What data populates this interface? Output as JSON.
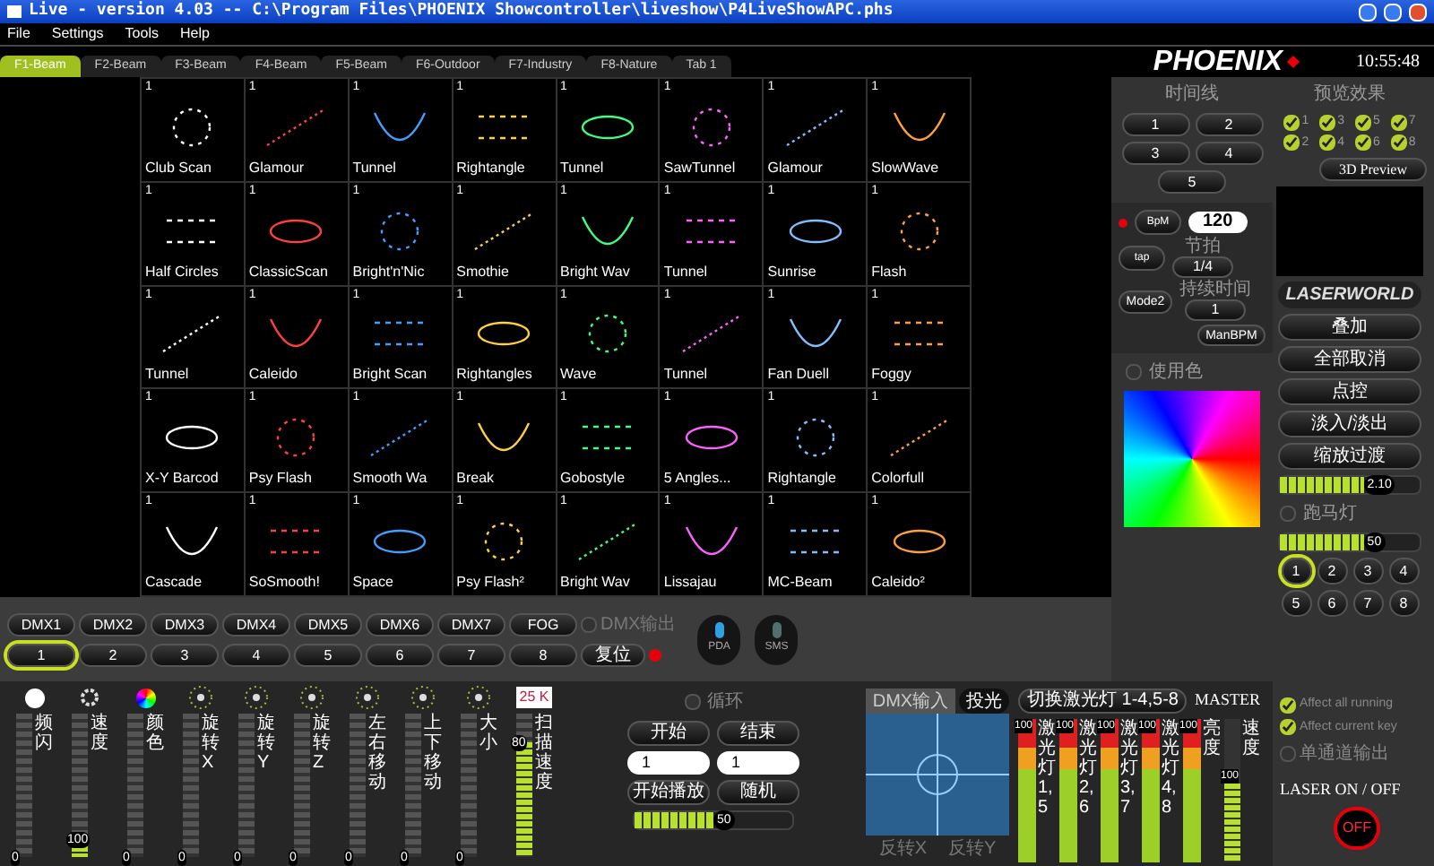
{
  "window": {
    "title": "Live - version 4.03 -- C:\\Program Files\\PHOENIX Showcontroller\\liveshow\\P4LiveShowAPC.phs"
  },
  "menu": [
    "File",
    "Settings",
    "Tools",
    "Help"
  ],
  "tabs": [
    {
      "label": "F1-Beam",
      "selected": true
    },
    {
      "label": "F2-Beam",
      "selected": false
    },
    {
      "label": "F3-Beam",
      "selected": false
    },
    {
      "label": "F4-Beam",
      "selected": false
    },
    {
      "label": "F5-Beam",
      "selected": false
    },
    {
      "label": "F6-Outdoor",
      "selected": false
    },
    {
      "label": "F7-Industry",
      "selected": false
    },
    {
      "label": "F8-Nature",
      "selected": false
    },
    {
      "label": "Tab 1",
      "selected": false
    }
  ],
  "header": {
    "logo": "PHOENIX",
    "clock": "10:55:48"
  },
  "effects": [
    {
      "number": "1",
      "label": "Club Scan"
    },
    {
      "number": "1",
      "label": "Glamour"
    },
    {
      "number": "1",
      "label": "Tunnel"
    },
    {
      "number": "1",
      "label": "Rightangle"
    },
    {
      "number": "1",
      "label": "Tunnel"
    },
    {
      "number": "1",
      "label": "SawTunnel"
    },
    {
      "number": "1",
      "label": "Glamour"
    },
    {
      "number": "1",
      "label": "SlowWave"
    },
    {
      "number": "1",
      "label": "Half Circles"
    },
    {
      "number": "1",
      "label": "ClassicScan"
    },
    {
      "number": "1",
      "label": "Bright'n'Nic"
    },
    {
      "number": "1",
      "label": "Smothie"
    },
    {
      "number": "1",
      "label": "Bright Wav"
    },
    {
      "number": "1",
      "label": "Tunnel"
    },
    {
      "number": "1",
      "label": "Sunrise"
    },
    {
      "number": "1",
      "label": "Flash"
    },
    {
      "number": "1",
      "label": "Tunnel"
    },
    {
      "number": "1",
      "label": "Caleido"
    },
    {
      "number": "1",
      "label": "Bright Scan"
    },
    {
      "number": "1",
      "label": "Rightangles"
    },
    {
      "number": "1",
      "label": "Wave"
    },
    {
      "number": "1",
      "label": "Tunnel"
    },
    {
      "number": "1",
      "label": "Fan Duell"
    },
    {
      "number": "1",
      "label": "Foggy"
    },
    {
      "number": "1",
      "label": "X-Y Barcod"
    },
    {
      "number": "1",
      "label": "Psy Flash"
    },
    {
      "number": "1",
      "label": "Smooth Wa"
    },
    {
      "number": "1",
      "label": "Break"
    },
    {
      "number": "1",
      "label": "Gobostyle"
    },
    {
      "number": "1",
      "label": "5 Angles..."
    },
    {
      "number": "1",
      "label": "Rightangle"
    },
    {
      "number": "1",
      "label": "Colorfull"
    },
    {
      "number": "1",
      "label": "Cascade"
    },
    {
      "number": "1",
      "label": "SoSmooth!"
    },
    {
      "number": "1",
      "label": "Space"
    },
    {
      "number": "1",
      "label": "Psy Flash²"
    },
    {
      "number": "1",
      "label": "Bright Wav"
    },
    {
      "number": "1",
      "label": "Lissajau"
    },
    {
      "number": "1",
      "label": "MC-Beam"
    },
    {
      "number": "1",
      "label": "Caleido²"
    }
  ],
  "dmx": {
    "channels": [
      "DMX1",
      "DMX2",
      "DMX3",
      "DMX4",
      "DMX5",
      "DMX6",
      "DMX7",
      "FOG"
    ],
    "output": {
      "label": "DMX输出",
      "checked": false
    },
    "keys": [
      {
        "label": "1",
        "selected": true
      },
      {
        "label": "2",
        "selected": false
      },
      {
        "label": "3",
        "selected": false
      },
      {
        "label": "4",
        "selected": false
      },
      {
        "label": "5",
        "selected": false
      },
      {
        "label": "6",
        "selected": false
      },
      {
        "label": "7",
        "selected": false
      },
      {
        "label": "8",
        "selected": false
      }
    ],
    "reset": "复位"
  },
  "remote": [
    "PDA",
    "SMS"
  ],
  "channels": [
    {
      "label": "频闪",
      "reading": "0",
      "level": 0
    },
    {
      "label": "速度",
      "reading": "100",
      "level": 0.12
    },
    {
      "label": "颜色",
      "reading": "0",
      "level": 0
    },
    {
      "label": "旋转X",
      "reading": "0",
      "level": 0
    },
    {
      "label": "旋转Y",
      "reading": "0",
      "level": 0
    },
    {
      "label": "旋转Z",
      "reading": "0",
      "level": 0
    },
    {
      "label": "左右移动",
      "reading": "0",
      "level": 0
    },
    {
      "label": "上下移动",
      "reading": "0",
      "level": 0
    },
    {
      "label": "大小",
      "reading": "0",
      "level": 0
    },
    {
      "label": "扫描速度",
      "reading": "80",
      "level": 0.8
    }
  ],
  "color_temp": "25 K",
  "playback": {
    "loop": {
      "label": "循环",
      "checked": false
    },
    "start": "开始",
    "end": "结束",
    "start_value": "1",
    "end_value": "1",
    "play": "开始播放",
    "random": "随机",
    "speed": {
      "reading": "50",
      "level": 0.5
    }
  },
  "xy_pad": {
    "tabs": [
      {
        "label": "DMX输入",
        "selected": true
      },
      {
        "label": "投光",
        "selected": false
      }
    ],
    "invert": [
      "反转X",
      "反转Y"
    ]
  },
  "lasers": {
    "switch": "切换激光灯 1-4,5-8",
    "master": "MASTER",
    "meters": [
      {
        "label": "激光灯1,5",
        "reading": "100",
        "level": 1
      },
      {
        "label": "激光灯2,6",
        "reading": "100",
        "level": 1
      },
      {
        "label": "激光灯3,7",
        "reading": "100",
        "level": 1
      },
      {
        "label": "激光灯4,8",
        "reading": "100",
        "level": 1
      },
      {
        "label": "亮度",
        "reading": "100",
        "level": 1
      }
    ],
    "speed": {
      "label": "速度",
      "reading": "100",
      "level": 0.55
    }
  },
  "timeline": {
    "label": "时间线",
    "buttons": [
      "1",
      "2",
      "3",
      "4",
      "5"
    ]
  },
  "preview": {
    "label": "预览效果",
    "button": "3D Preview",
    "checks": [
      {
        "label": "1",
        "checked": true
      },
      {
        "label": "2",
        "checked": true
      },
      {
        "label": "3",
        "checked": true
      },
      {
        "label": "4",
        "checked": true
      },
      {
        "label": "5",
        "checked": true
      },
      {
        "label": "6",
        "checked": true
      },
      {
        "label": "7",
        "checked": true
      },
      {
        "label": "8",
        "checked": true
      }
    ]
  },
  "bpm": {
    "value": "120",
    "bpm_button": "BpM",
    "beat_label": "节拍",
    "beat": "1/4",
    "tap_button": "tap",
    "duration_label": "持续时间",
    "duration": "1",
    "mode": "Mode2",
    "manual": "ManBPM"
  },
  "color_picker": {
    "label": "使用色",
    "checked": false
  },
  "brand": "LASERWORLD",
  "actions": [
    "叠加",
    "全部取消",
    "点控",
    "淡入/淡出",
    "缩放过渡"
  ],
  "fade": {
    "reading": "2.10",
    "level": 0.6
  },
  "chase": {
    "label": "跑马灯",
    "checked": false,
    "reading": "50",
    "level": 0.6
  },
  "banks": [
    {
      "label": "1",
      "selected": true
    },
    {
      "label": "2",
      "selected": false
    },
    {
      "label": "3",
      "selected": false
    },
    {
      "label": "4",
      "selected": false
    },
    {
      "label": "5",
      "selected": false
    },
    {
      "label": "6",
      "selected": false
    },
    {
      "label": "7",
      "selected": false
    },
    {
      "label": "8",
      "selected": false
    }
  ],
  "options": [
    {
      "label": "Affect all running",
      "checked": true
    },
    {
      "label": "Affect current key",
      "checked": true
    },
    {
      "label": "单通道输出",
      "checked": false
    }
  ],
  "laser_toggle": {
    "label": "LASER ON / OFF",
    "button": "OFF"
  }
}
